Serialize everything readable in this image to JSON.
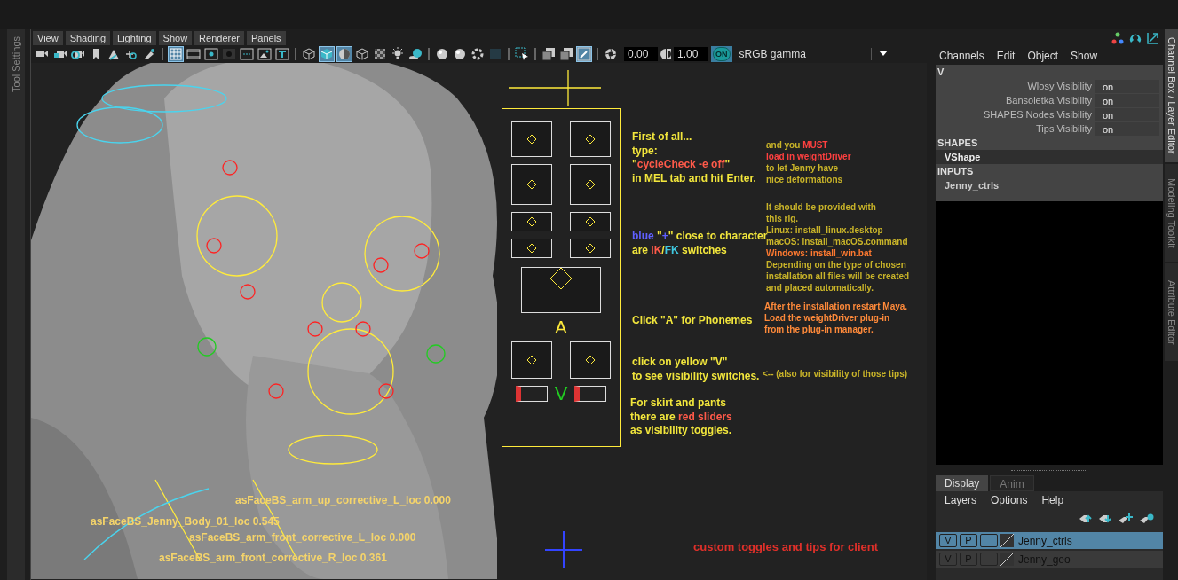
{
  "left_strip": {
    "label": "Tool Settings"
  },
  "viewport": {
    "menus": [
      "View",
      "Shading",
      "Lighting",
      "Show",
      "Renderer",
      "Panels"
    ],
    "toolbar": [
      {
        "kind": "camera",
        "selected": false
      },
      {
        "kind": "camera-lock",
        "selected": false
      },
      {
        "kind": "camera-gear",
        "selected": false
      },
      {
        "kind": "bookmark",
        "selected": false
      },
      {
        "kind": "grid-2d",
        "selected": false
      },
      {
        "kind": "move-search",
        "selected": false
      },
      {
        "kind": "brush",
        "selected": false
      },
      {
        "kind": "sep"
      },
      {
        "kind": "grid",
        "selected": true
      },
      {
        "kind": "film",
        "selected": false
      },
      {
        "kind": "dot",
        "selected": false
      },
      {
        "kind": "dark-dot",
        "selected": false
      },
      {
        "kind": "safe",
        "selected": false
      },
      {
        "kind": "image",
        "selected": false
      },
      {
        "kind": "text",
        "selected": false
      },
      {
        "kind": "sep"
      },
      {
        "kind": "wire-cube",
        "selected": false
      },
      {
        "kind": "solid-cube",
        "selected": true
      },
      {
        "kind": "half-sphere",
        "selected": true
      },
      {
        "kind": "wire-cube",
        "selected": false
      },
      {
        "kind": "checker",
        "selected": false
      },
      {
        "kind": "light",
        "selected": false
      },
      {
        "kind": "shadow",
        "selected": false
      },
      {
        "kind": "sep"
      },
      {
        "kind": "sphere",
        "selected": false
      },
      {
        "kind": "sphere",
        "selected": false
      },
      {
        "kind": "ring",
        "selected": false
      },
      {
        "kind": "square",
        "selected": false
      },
      {
        "kind": "sep"
      },
      {
        "kind": "select",
        "selected": false
      },
      {
        "kind": "sep"
      },
      {
        "kind": "overlap",
        "selected": false
      },
      {
        "kind": "overlap",
        "selected": false
      },
      {
        "kind": "picker",
        "selected": true
      },
      {
        "kind": "sep"
      },
      {
        "kind": "aperture",
        "selected": false
      }
    ],
    "exposure": "0.00",
    "gamma": "1.00",
    "color_management": "ON",
    "color_space": "sRGB gamma",
    "notes": [
      {
        "lines": [
          [
            {
              "text": "First of all...",
              "color": "#f2e63c"
            }
          ],
          [
            {
              "text": "type:",
              "color": "#f2e63c"
            }
          ],
          [
            {
              "text": "\"",
              "color": "#f2e63c"
            },
            {
              "text": "cycleCheck -e off",
              "color": "#ff5a4a"
            },
            {
              "text": "\"",
              "color": "#f2e63c"
            }
          ],
          [
            {
              "text": "in MEL tab and hit Enter.",
              "color": "#f2e63c"
            }
          ]
        ]
      },
      {
        "lines": [
          [
            {
              "text": "blue",
              "color": "#6060ff"
            },
            {
              "text": " \"",
              "color": "#f2e63c"
            },
            {
              "text": "+",
              "color": "#6060ff"
            },
            {
              "text": "\" close to character",
              "color": "#f2e63c"
            }
          ],
          [
            {
              "text": "are ",
              "color": "#f2e63c"
            },
            {
              "text": "IK",
              "color": "#ff5a4a"
            },
            {
              "text": "/",
              "color": "#f2e63c"
            },
            {
              "text": "FK",
              "color": "#40c8e0"
            },
            {
              "text": " switches",
              "color": "#f2e63c"
            }
          ]
        ]
      },
      {
        "lines": [
          [
            {
              "text": "Click \"A\" for Phonemes",
              "color": "#f2e63c"
            }
          ]
        ]
      },
      {
        "lines": [
          [
            {
              "text": "click on yellow \"V\"",
              "color": "#f2e63c"
            }
          ],
          [
            {
              "text": "to see visibility switches.",
              "color": "#f2e63c"
            }
          ]
        ]
      },
      {
        "lines": [
          [
            {
              "text": "For skirt and pants",
              "color": "#f2e63c"
            }
          ],
          [
            {
              "text": "there are ",
              "color": "#f2e63c"
            },
            {
              "text": "red sliders",
              "color": "#ff5a4a"
            }
          ],
          [
            {
              "text": "as visibility toggles.",
              "color": "#f2e63c"
            }
          ]
        ]
      },
      {
        "lines": [
          [
            {
              "text": "and you ",
              "color": "#c9b429"
            },
            {
              "text": "MUST",
              "color": "#ff4040"
            }
          ],
          [
            {
              "text": "load in weightDriver",
              "color": "#ff4040"
            }
          ],
          [
            {
              "text": "to let Jenny have",
              "color": "#c9b429"
            }
          ],
          [
            {
              "text": "nice deformations",
              "color": "#c9b429"
            }
          ]
        ]
      },
      {
        "lines": [
          [
            {
              "text": "It should be provided with",
              "color": "#c9b429"
            }
          ],
          [
            {
              "text": "this rig.",
              "color": "#c9b429"
            }
          ],
          [
            {
              "text": "Linux: install_linux.desktop",
              "color": "#c9b429"
            }
          ],
          [
            {
              "text": "macOS: install_macOS.command",
              "color": "#c9b429"
            }
          ],
          [
            {
              "text": "Windows: ",
              "color": "#ff7a30"
            },
            {
              "text": "install_win.bat",
              "color": "#ff7a30"
            }
          ],
          [
            {
              "text": "Depending on the type of chosen",
              "color": "#c9b429"
            }
          ],
          [
            {
              "text": "installation all files will be created",
              "color": "#c9b429"
            }
          ],
          [
            {
              "text": "and placed automatically.",
              "color": "#c9b429"
            }
          ]
        ]
      },
      {
        "lines": [
          [
            {
              "text": "After the installation restart Maya.",
              "color": "#ff8a3a"
            }
          ],
          [
            {
              "text": "Load the weightDriver plug-in",
              "color": "#ff8a3a"
            }
          ],
          [
            {
              "text": "from the plug-in manager.",
              "color": "#ff8a3a"
            }
          ]
        ]
      },
      {
        "lines": [
          [
            {
              "text": "<-- (also for visibility of those tips)",
              "color": "#c9b429"
            }
          ]
        ]
      },
      {
        "lines": [
          [
            {
              "text": "custom toggles and tips for client",
              "color": "#e0302a"
            }
          ]
        ]
      }
    ],
    "panel_letters": [
      "A",
      "V"
    ],
    "locators": [
      "asFaceBS_arm_up_corrective_L_loc 0.000",
      "asFaceBS_Jenny_Body_01_loc 0.545",
      "asFaceBS_arm_front_corrective_L_loc 0.000",
      "asFaceBS_arm_front_corrective_R_loc 0.361"
    ]
  },
  "channel_box": {
    "menus": [
      "Channels",
      "Edit",
      "Object",
      "Show"
    ],
    "node": "V",
    "attributes": [
      {
        "name": "Wlosy Visibility",
        "value": "on"
      },
      {
        "name": "Bansoletka Visibility",
        "value": "on"
      },
      {
        "name": "SHAPES Nodes Visibility",
        "value": "on"
      },
      {
        "name": "Tips Visibility",
        "value": "on"
      }
    ],
    "sections": [
      {
        "title": "SHAPES",
        "item": "VShape",
        "selected": true
      },
      {
        "title": "INPUTS",
        "item": "Jenny_ctrls",
        "selected": false
      }
    ]
  },
  "layer_editor": {
    "tabs": [
      {
        "label": "Display",
        "selected": true
      },
      {
        "label": "Anim",
        "selected": false
      }
    ],
    "menus": [
      "Layers",
      "Options",
      "Help"
    ],
    "layers": [
      {
        "visible": "V",
        "playback": "P",
        "name": "Jenny_ctrls",
        "selected": true
      },
      {
        "visible": "V",
        "playback": "P",
        "name": "Jenny_geo",
        "selected": false
      }
    ]
  },
  "side_tabs": [
    {
      "label": "Channel Box / Layer Editor",
      "selected": true
    },
    {
      "label": "Modeling Toolkit",
      "selected": false
    },
    {
      "label": "Attribute Editor",
      "selected": false
    }
  ]
}
